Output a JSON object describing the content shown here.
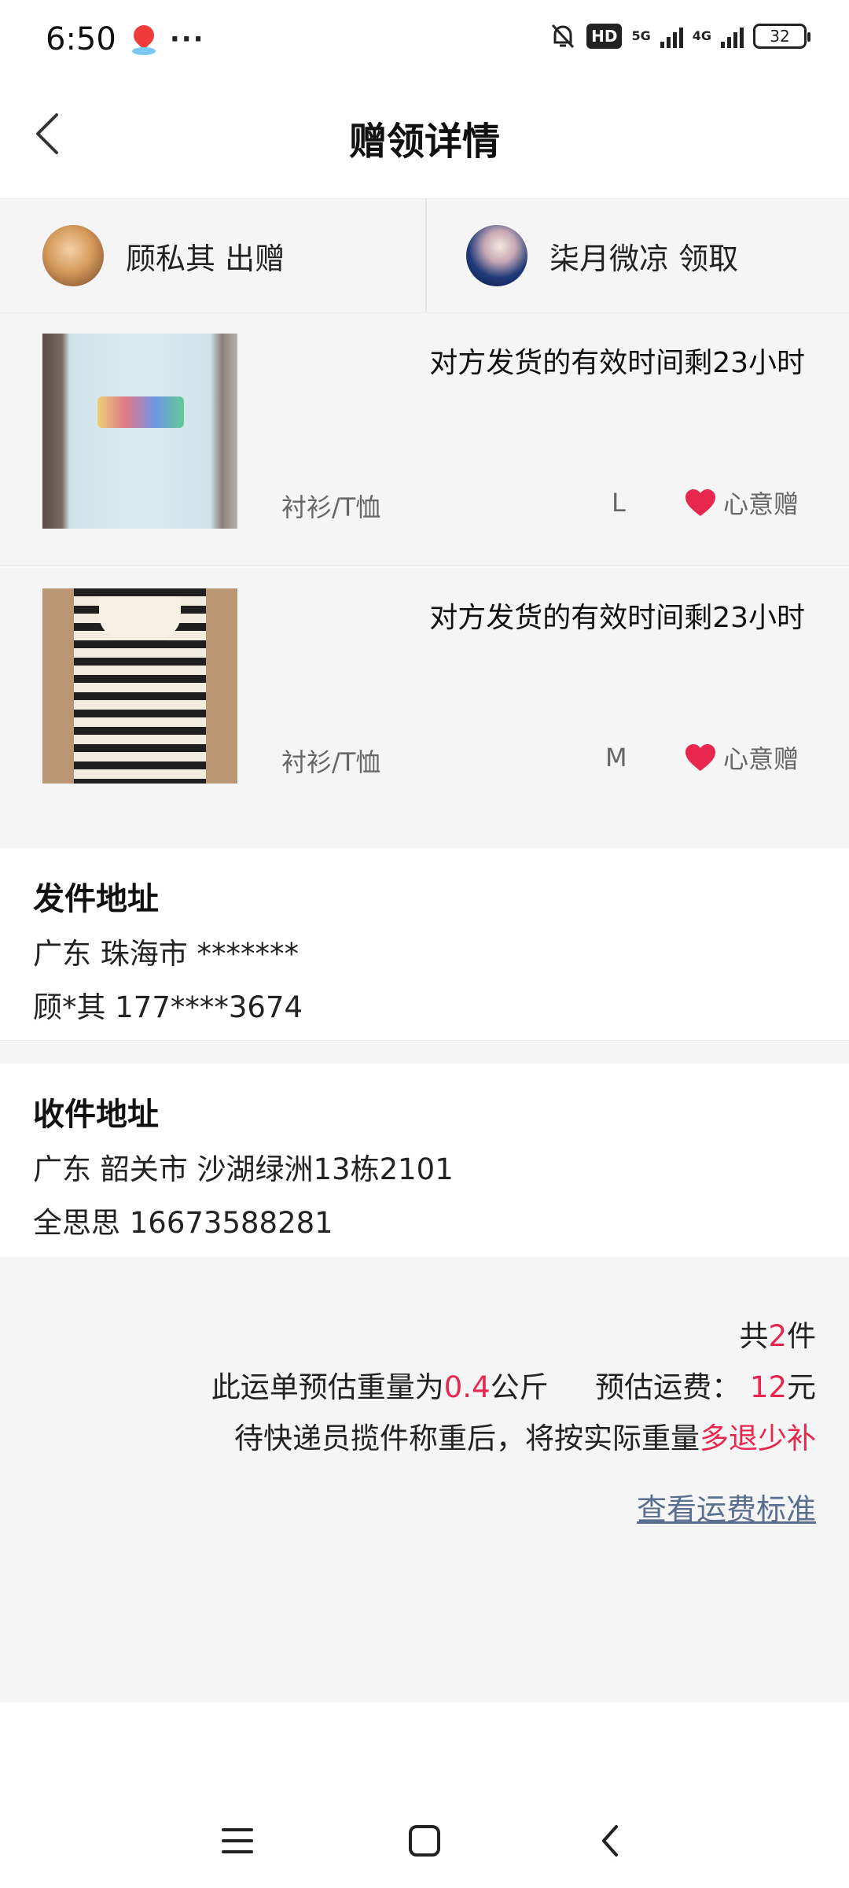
{
  "status_bar": {
    "time": "6:50",
    "more": "···",
    "hd_badge": "HD",
    "net_5g": "5G",
    "net_4g": "4G",
    "battery": "32"
  },
  "header": {
    "title": "赠领详情",
    "back_icon": "chevron-left-icon"
  },
  "parties": {
    "giver": {
      "name": "顾私其 出赠",
      "avatar": "cat-avatar"
    },
    "receiver": {
      "name": "柒月微凉 领取",
      "avatar": "girl-avatar"
    }
  },
  "items": [
    {
      "note": "对方发货的有效时间剩23小时",
      "category": "衬衫/T恤",
      "size": "L",
      "tag": "心意赠",
      "photo": "light-blue-tshirt"
    },
    {
      "note": "对方发货的有效时间剩23小时",
      "category": "衬衫/T恤",
      "size": "M",
      "tag": "心意赠",
      "photo": "striped-polo-shirt"
    }
  ],
  "sender_address": {
    "title": "发件地址",
    "line1": "广东 珠海市 *******",
    "line2": "顾*其 177****3674"
  },
  "receiver_address": {
    "title": "收件地址",
    "line1": "广东 韶关市 沙湖绿洲13栋2101",
    "line2": "全思思 16673588281"
  },
  "summary": {
    "count_prefix": "共",
    "count": "2",
    "count_suffix": "件",
    "weight_prefix": "此运单预估重量为",
    "weight": "0.4",
    "weight_unit": "公斤",
    "fee_label": "预估运费：",
    "fee": "12",
    "fee_unit": "元",
    "rule_text": "待快递员揽件称重后，将按实际重量",
    "rule_highlight": "多退少补",
    "link": "查看运费标准"
  },
  "colors": {
    "accent_red": "#e8274f",
    "link": "#5a6f8f",
    "panel_bg": "#f5f5f5"
  }
}
